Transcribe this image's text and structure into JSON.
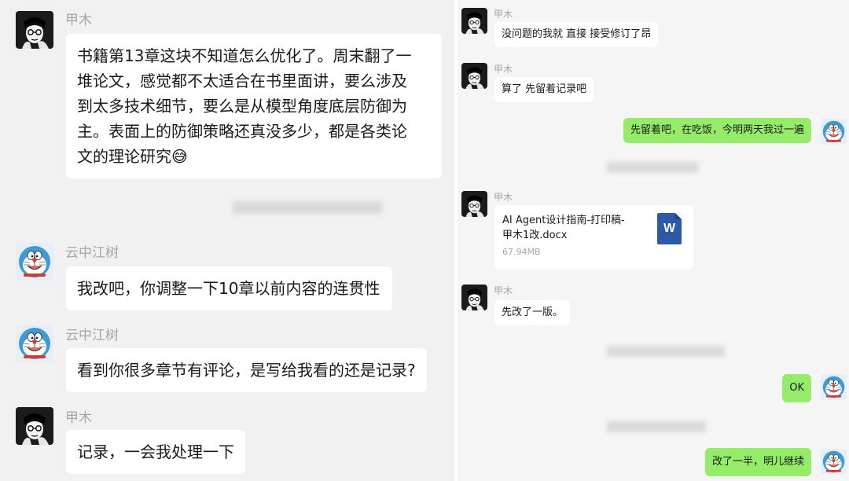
{
  "left_chat": {
    "messages": [
      {
        "sender": "甲木",
        "lines": [
          "书籍第13章这块不知道怎么优化了。周末翻了一",
          "堆论文，感觉都不太适合在书里面讲，要么涉及",
          "到太多技术细节，要么是从模型角度底层防御为",
          "主。表面上的防御策略还真没多少，都是各类论",
          "文的理论研究"
        ],
        "emoji": "😅"
      },
      {
        "sender": "云中江树",
        "text": "我改吧，你调整一下10章以前内容的连贯性"
      },
      {
        "sender": "云中江树",
        "text": "看到你很多章节有评论，是写给我看的还是记录?"
      },
      {
        "sender": "甲木",
        "text": "记录，一会我处理一下"
      }
    ]
  },
  "right_chat": {
    "messages": [
      {
        "sender": "甲木",
        "text": "没问题的我就 直接 接受修订了昂"
      },
      {
        "sender": "甲木",
        "text": "算了 先留着记录吧"
      },
      {
        "sender": "self",
        "text": "先留着吧，在吃饭，今明两天我过一遍"
      },
      {
        "sender": "甲木",
        "file": {
          "name_line1": "AI Agent设计指南-打印稿-",
          "name_line2": "甲木1改.docx",
          "size": "67.94MB",
          "icon_letter": "W"
        }
      },
      {
        "sender": "甲木",
        "text": "先改了一版。"
      },
      {
        "sender": "self",
        "text": "OK"
      },
      {
        "sender": "self",
        "text": "改了一半，明儿继续"
      }
    ]
  },
  "colors": {
    "self_bubble": "#95ec69",
    "other_bubble": "#ffffff",
    "name_text": "#a6a6a6",
    "word_icon": "#2b5aa8"
  }
}
